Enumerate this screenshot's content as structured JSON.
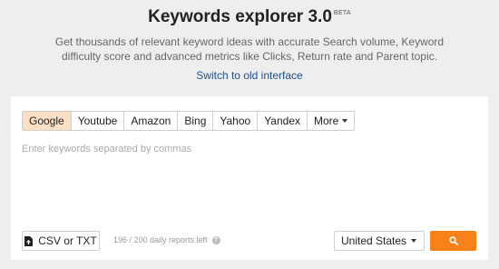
{
  "header": {
    "title": "Keywords explorer 3.0",
    "badge": "BETA",
    "subtitle": "Get thousands of relevant keyword ideas with accurate Search volume, Keyword difficulty score and advanced metrics like Clicks, Return rate and Parent topic.",
    "switch_link": "Switch to old interface"
  },
  "engines": [
    {
      "label": "Google",
      "active": true
    },
    {
      "label": "Youtube",
      "active": false
    },
    {
      "label": "Amazon",
      "active": false
    },
    {
      "label": "Bing",
      "active": false
    },
    {
      "label": "Yahoo",
      "active": false
    },
    {
      "label": "Yandex",
      "active": false
    },
    {
      "label": "More",
      "active": false
    }
  ],
  "search": {
    "placeholder": "Enter keywords separated by commas",
    "value": ""
  },
  "footer": {
    "upload_label": "CSV or TXT",
    "upload_icon": "file-upload-icon",
    "reports_left": "196 / 200 daily reports left",
    "help_icon": "help-icon",
    "country": "United States",
    "search_icon": "search-icon"
  },
  "colors": {
    "background": "#eeeeef",
    "accent": "#f7821b",
    "active_tab": "#fbdfc4",
    "link": "#1d4f8f"
  }
}
